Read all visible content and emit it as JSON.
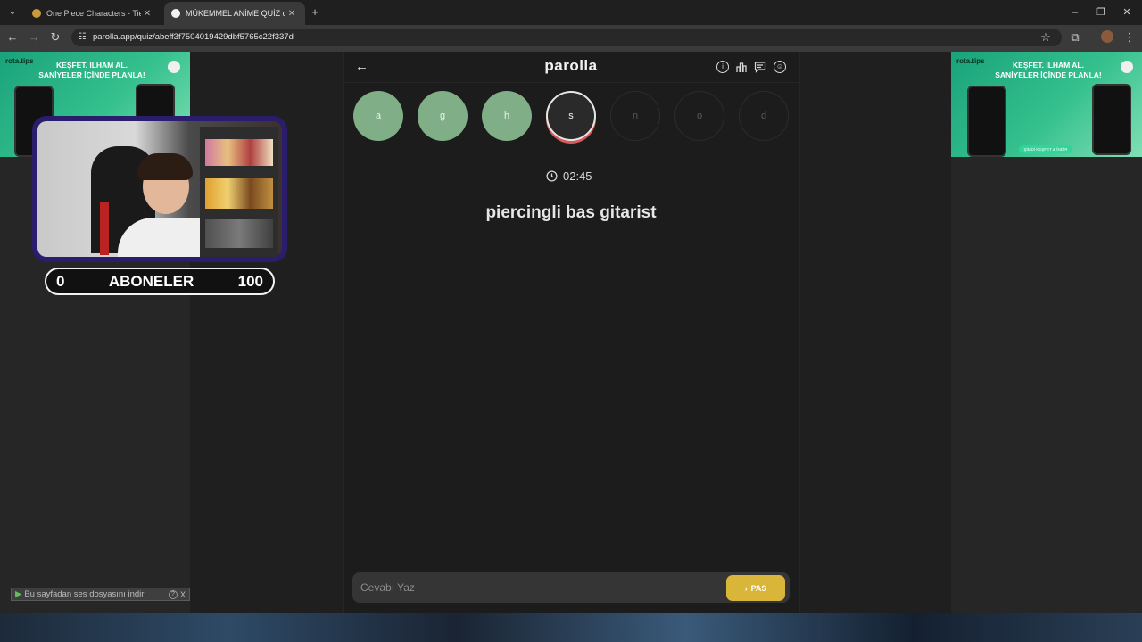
{
  "browser": {
    "tabs": [
      {
        "title": "One Piece Characters - Tier List",
        "close": "✕"
      },
      {
        "title": "MÜKEMMEL ANİME QUİZ quiz",
        "close": "✕"
      }
    ],
    "new_tab": "+",
    "url": "parolla.app/quiz/abeff3f7504019429dbf5765c22f337d"
  },
  "ads": {
    "brand": "rota.tips",
    "line1": "KEŞFET. İLHAM AL.",
    "line2": "SANİYELER İÇİNDE PLANLA!",
    "cta": "ŞİMDİ KEŞFET & İNDİR"
  },
  "webcam_overlay": {
    "sub_min": "0",
    "sub_label": "ABONELER",
    "sub_max": "100"
  },
  "download_bar": {
    "text": "Bu sayfadan ses dosyasını indir",
    "help": "?",
    "close": "X"
  },
  "app": {
    "logo": "parolla",
    "letters": [
      {
        "char": "a",
        "state": "correct"
      },
      {
        "char": "g",
        "state": "correct"
      },
      {
        "char": "h",
        "state": "correct"
      },
      {
        "char": "s",
        "state": "current"
      },
      {
        "char": "n",
        "state": "pending"
      },
      {
        "char": "o",
        "state": "pending"
      },
      {
        "char": "d",
        "state": "pending"
      }
    ],
    "timer": "02:45",
    "question": "piercingli bas gitarist",
    "answer_placeholder": "Cevabı Yaz",
    "pass_label": "PAS"
  },
  "colors": {
    "correct": "#7fae87",
    "pass_button": "#d9b53a",
    "current_underline": "#d65a5a"
  }
}
